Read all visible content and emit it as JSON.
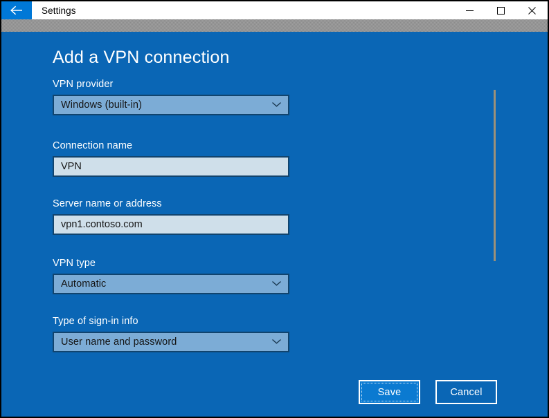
{
  "window": {
    "title": "Settings",
    "back_icon": "back-arrow-icon",
    "controls": {
      "minimize": "minimize-icon",
      "maximize": "maximize-icon",
      "close": "close-icon"
    }
  },
  "page": {
    "heading": "Add a VPN connection"
  },
  "fields": {
    "provider": {
      "label": "VPN provider",
      "value": "Windows (built-in)",
      "type": "dropdown",
      "chevron": "chevron-down-icon"
    },
    "connection_name": {
      "label": "Connection name",
      "value": "VPN",
      "placeholder": "",
      "type": "text"
    },
    "server": {
      "label": "Server name or address",
      "value": "vpn1.contoso.com",
      "placeholder": "",
      "type": "text"
    },
    "vpn_type": {
      "label": "VPN type",
      "value": "Automatic",
      "type": "dropdown",
      "chevron": "chevron-down-icon"
    },
    "sign_in_type": {
      "label": "Type of sign-in info",
      "value": "User name and password",
      "type": "dropdown",
      "chevron": "chevron-down-icon"
    }
  },
  "buttons": {
    "save": "Save",
    "cancel": "Cancel"
  },
  "colors": {
    "accent_background": "#0a66b5",
    "titlebar_background": "#ffffff",
    "back_button": "#0078d7",
    "input_fill": "#cfdfea",
    "dropdown_fill": "#7cacd6",
    "field_border": "#11446e",
    "save_fill": "#0b7ad1",
    "scrollbar_thumb": "#9c9179",
    "text_on_accent": "#ffffff"
  }
}
